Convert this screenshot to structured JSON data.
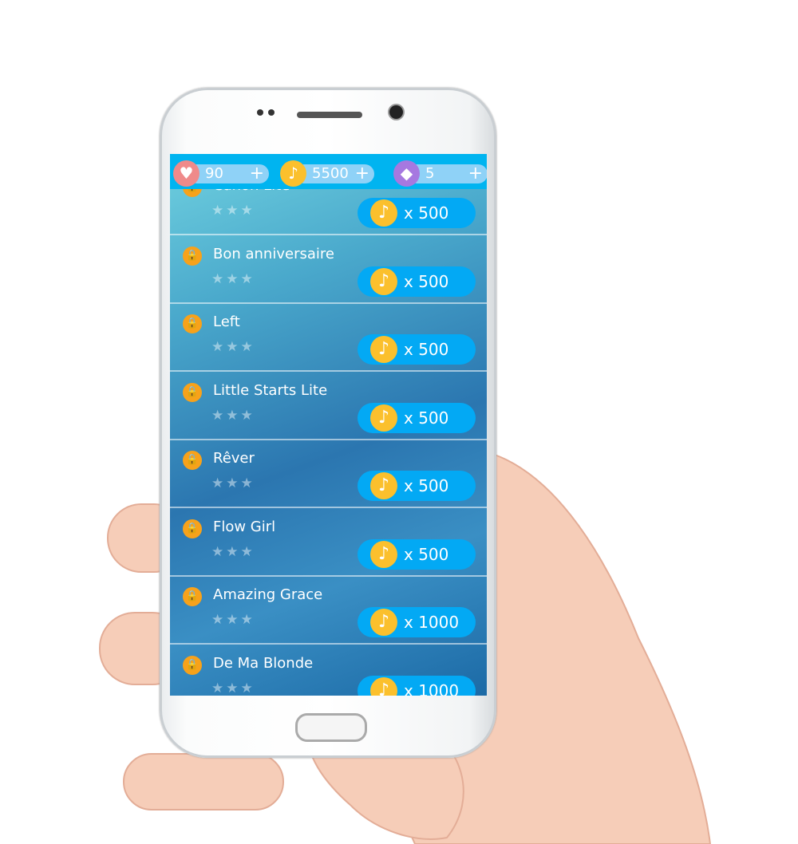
{
  "topbar": {
    "lives": {
      "icon": "heart-icon",
      "value": "90",
      "plus": "+",
      "color": "#ef8a8a"
    },
    "coins": {
      "icon": "music-note-icon",
      "value": "5500",
      "plus": "+",
      "color": "#fbc02d"
    },
    "gems": {
      "icon": "diamond-icon",
      "value": "5",
      "plus": "+",
      "color": "#a678e0"
    }
  },
  "songs": [
    {
      "title": "Canon Lite",
      "stars": "★★★",
      "price": "x 500"
    },
    {
      "title": "Bon anniversaire",
      "stars": "★★★",
      "price": "x 500"
    },
    {
      "title": "Left",
      "stars": "★★★",
      "price": "x 500"
    },
    {
      "title": "Little Starts Lite",
      "stars": "★★★",
      "price": "x 500"
    },
    {
      "title": "Rêver",
      "stars": "★★★",
      "price": "x 500"
    },
    {
      "title": "Flow Girl",
      "stars": "★★★",
      "price": "x 500"
    },
    {
      "title": "Amazing Grace",
      "stars": "★★★",
      "price": "x 1000"
    },
    {
      "title": "De Ma Blonde",
      "stars": "★★★",
      "price": "x 1000"
    }
  ],
  "icons": {
    "lock": "lock-icon",
    "note": "♪",
    "heart": "♥",
    "diamond": "◆"
  },
  "colors": {
    "accent": "#03a9f4",
    "topbar": "#00b4f0",
    "lock": "#f7a21b"
  }
}
